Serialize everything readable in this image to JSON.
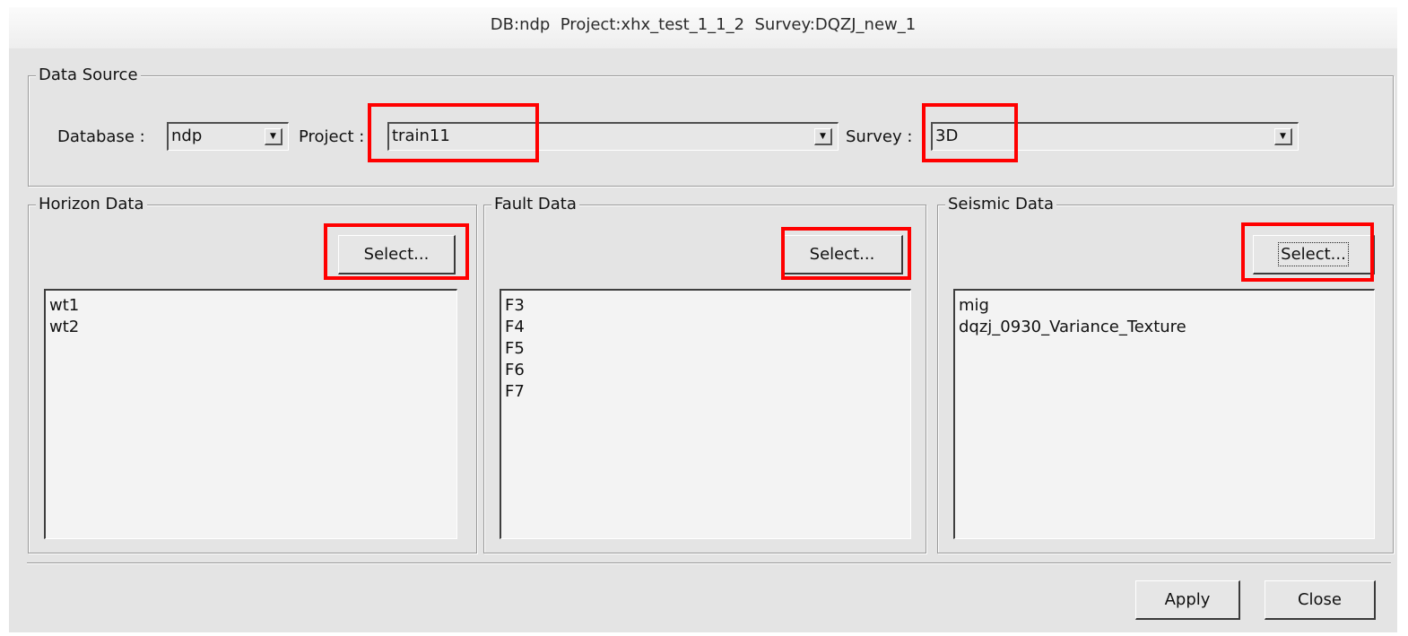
{
  "window": {
    "title": "DB:ndp  Project:xhx_test_1_1_2  Survey:DQZJ_new_1"
  },
  "data_source": {
    "group_title": "Data Source",
    "database_label": "Database :",
    "database_value": "ndp",
    "project_label": "Project :",
    "project_value": "train11",
    "survey_label": "Survey :",
    "survey_value": "3D",
    "dropdown_glyph": "▼"
  },
  "horizon": {
    "group_title": "Horizon Data",
    "select_label": "Select...",
    "items": [
      "wt1",
      "wt2"
    ]
  },
  "fault": {
    "group_title": "Fault Data",
    "select_label": "Select...",
    "items": [
      "F3",
      "F4",
      "F5",
      "F6",
      "F7"
    ]
  },
  "seismic": {
    "group_title": "Seismic Data",
    "select_label": "Select...",
    "items": [
      "mig",
      "dqzj_0930_Variance_Texture"
    ]
  },
  "footer": {
    "apply_label": "Apply",
    "close_label": "Close"
  },
  "annotation": {
    "highlight_color": "#ff0000"
  }
}
